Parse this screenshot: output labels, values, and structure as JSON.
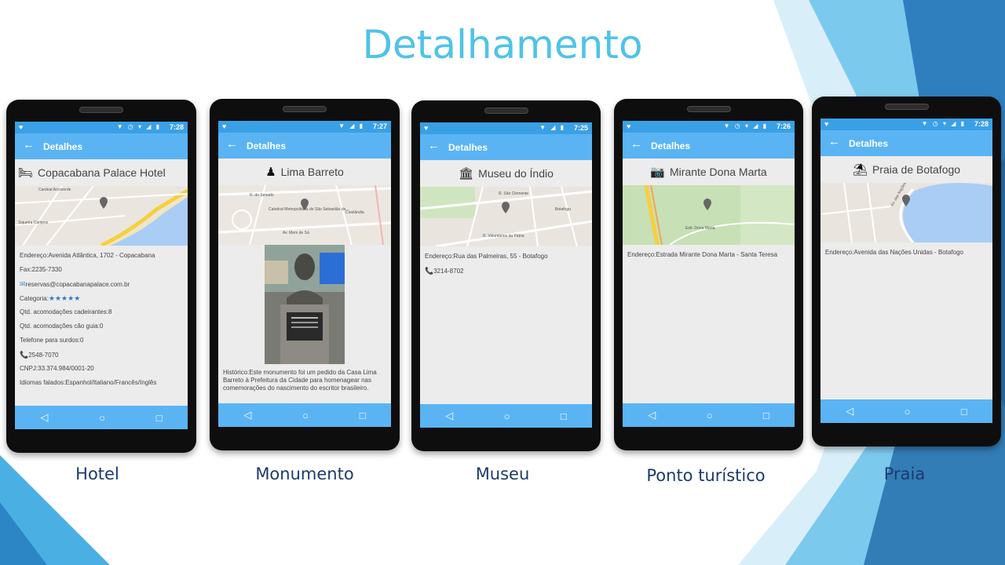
{
  "slide": {
    "title": "Detalhamento",
    "accent_color": "#4fc3e8",
    "caption_color": "#1d3a6e"
  },
  "common": {
    "app_title": "Detalhes",
    "back_icon": "arrow-back-icon",
    "nav_back": "◁",
    "nav_home": "○",
    "nav_recent": "□"
  },
  "phones": [
    {
      "caption": "Hotel",
      "time": "7:28",
      "header_icon": "bed-icon",
      "header_title": "Copacabana Palace Hotel",
      "map_labels": [
        "Cardeal Arcoverde",
        "Siqueira Campos"
      ],
      "details": {
        "address": "Endereço:Avenida Atlântica, 1702 - Copacabana",
        "fax": "Fax:2235-7330",
        "email": "reservas@copacabanapalace.com.br",
        "category_label": "Categoria:",
        "stars": "★★★★★",
        "wheelchair": "Qtd. acomodações cadeirantes:8",
        "guide_dog": "Qtd. acomodações cão guia:0",
        "deaf_phone": "Telefone para surdos:0",
        "phone": "2548-7070",
        "cnpj": "CNPJ:33.374.984/0001-20",
        "languages": "Idiomas falados:Espanhol/Italiano/Francês/Inglês"
      }
    },
    {
      "caption": "Monumento",
      "time": "7:27",
      "header_icon": "monument-icon",
      "header_title": "Lima Barreto",
      "map_labels": [
        "Catedral Metropolitana de São Sebastião do...",
        "Cinelândia",
        "R. do Senado",
        "Av. Mem de Sá"
      ],
      "historic": "Histórico:Este monumento foi um pedido da Casa Lima Barreto à Prefeitura da Cidade para homenagear nas comemorações do nascimento do escritor brasileiro."
    },
    {
      "caption": "Museu",
      "time": "7:25",
      "header_icon": "museum-icon",
      "header_title": "Museu do Índio",
      "map_labels": [
        "R. São Clemente",
        "Botafogo",
        "R. Voluntários da Pátria"
      ],
      "details": {
        "address": "Endereço:Rua das Palmeiras, 55 - Botafogo",
        "phone": "3214-8702"
      }
    },
    {
      "caption": "Ponto turístico",
      "time": "7:26",
      "header_icon": "camera-icon",
      "header_title": "Mirante Dona Marta",
      "map_labels": [
        "Estr. Dona Marta"
      ],
      "details": {
        "address": "Endereço:Estrada Mirante Dona Marta - Santa Teresa"
      }
    },
    {
      "caption": "Praia",
      "time": "7:28",
      "header_icon": "beach-umbrella-icon",
      "header_title": "Praia de Botafogo",
      "map_labels": [
        "Av. das Nações Unidas"
      ],
      "details": {
        "address": "Endereço:Avenida das Nações Unidas - Botafogo"
      }
    }
  ]
}
